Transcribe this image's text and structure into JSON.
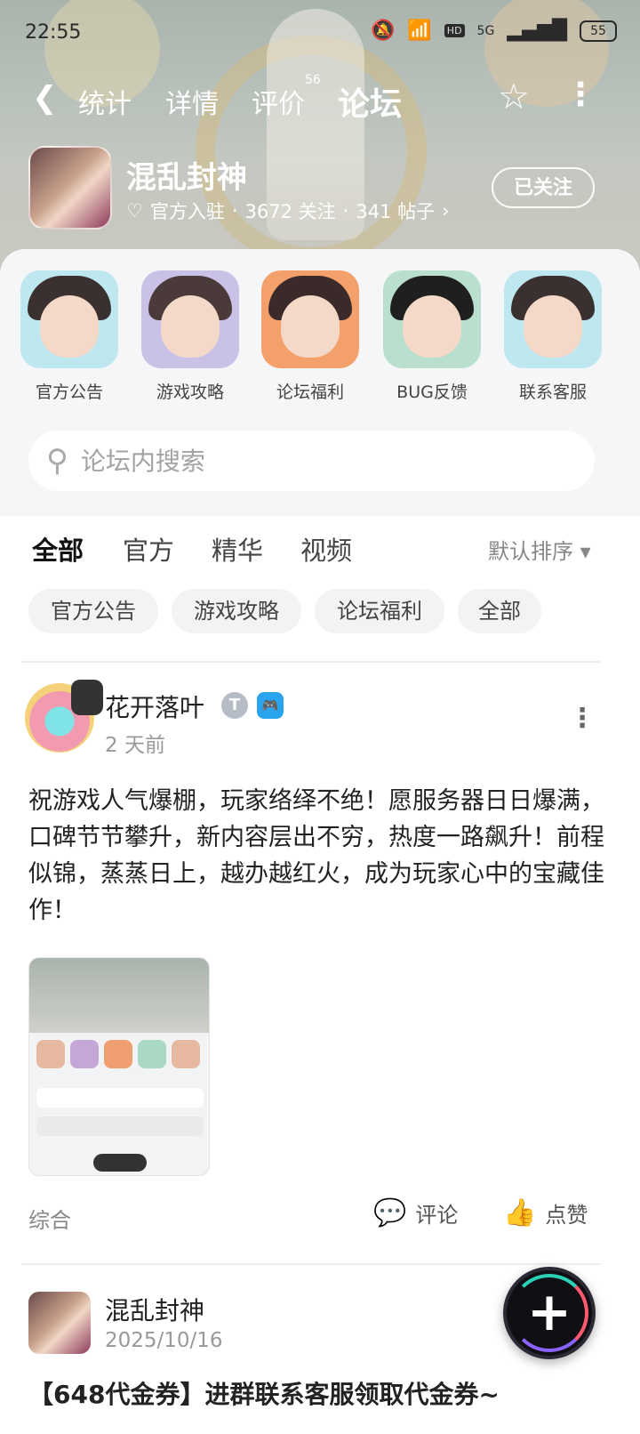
{
  "status_bar": {
    "time": "22:55",
    "battery": "55",
    "network": "5G",
    "hd": "HD"
  },
  "top_nav": {
    "tabs": [
      {
        "label": "统计"
      },
      {
        "label": "详情"
      },
      {
        "label": "评价",
        "badge": "56"
      },
      {
        "label": "论坛",
        "active": true
      }
    ]
  },
  "game": {
    "title": "混乱封神",
    "official": "官方入驻",
    "followers": "3672 关注",
    "posts": "341 帖子",
    "follow_label": "已关注"
  },
  "quick_links": [
    {
      "label": "官方公告"
    },
    {
      "label": "游戏攻略"
    },
    {
      "label": "论坛福利"
    },
    {
      "label": "BUG反馈"
    },
    {
      "label": "联系客服"
    }
  ],
  "search": {
    "placeholder": "论坛内搜索"
  },
  "feed_tabs": [
    {
      "label": "全部",
      "active": true
    },
    {
      "label": "官方"
    },
    {
      "label": "精华"
    },
    {
      "label": "视频"
    }
  ],
  "sort_label": "默认排序 ▾",
  "chips": [
    {
      "label": "官方公告"
    },
    {
      "label": "游戏攻略"
    },
    {
      "label": "论坛福利"
    },
    {
      "label": "全部"
    }
  ],
  "posts": [
    {
      "user": "花开落叶",
      "time": "2 天前",
      "body": "祝游戏人气爆棚，玩家络绎不绝！愿服务器日日爆满，口碑节节攀升，新内容层出不穷，热度一路飙升！前程似锦，蒸蒸日上，越办越红火，成为玩家心中的宝藏佳作！",
      "category": "综合",
      "comment_label": "评论",
      "like_label": "点赞"
    },
    {
      "user": "混乱封神",
      "time": "2025/10/16",
      "title": "【648代金券】进群联系客服领取代金券~"
    }
  ],
  "colors": {
    "accent": "#2bd3b6",
    "text": "#222222",
    "muted": "#999999"
  }
}
